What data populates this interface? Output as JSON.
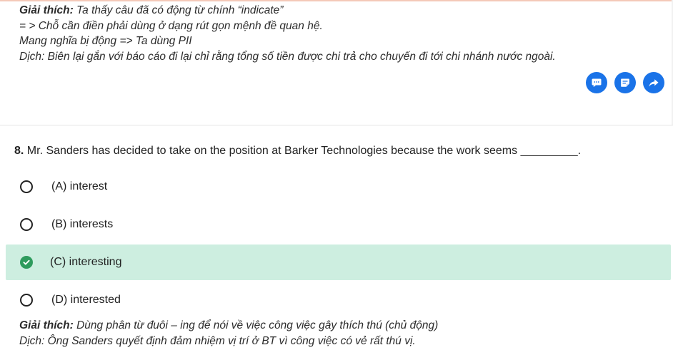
{
  "previous": {
    "explanation_label": "Giải thích:",
    "explanation_text": " Ta thấy câu đã có động từ chính “indicate”",
    "line2": "= > Chỗ cần điền phải dùng ở dạng rút gọn mệnh đề quan hệ.",
    "line3": "Mang nghĩa bị động => Ta dùng PII",
    "line4": "Dịch: Biên lại gắn với báo cáo đi lại chỉ rằng tổng số tiền được chi trả cho chuyến đi tới chi nhánh nước ngoài."
  },
  "actions": {
    "colors": {
      "button_bg": "#1a73e8"
    },
    "icons": [
      "comment-icon",
      "note-icon",
      "share-icon"
    ]
  },
  "question": {
    "number": "8.",
    "text": " Mr. Sanders has decided to take on the position at Barker Technologies because the work seems _________."
  },
  "options": [
    {
      "label": "(A) interest",
      "selected": false,
      "correct": false
    },
    {
      "label": "(B) interests",
      "selected": false,
      "correct": false
    },
    {
      "label": "(C) interesting",
      "selected": true,
      "correct": true
    },
    {
      "label": "(D) interested",
      "selected": false,
      "correct": false
    }
  ],
  "explanation": {
    "label": "Giải thích:",
    "text": " Dùng phân từ đuôi – ing để nói về việc công việc gây thích thú (chủ động)",
    "translation": "Dịch: Ông Sanders quyết định đảm nhiệm vị trí ở BT vì công việc có vẻ rất thú vị."
  },
  "colors": {
    "correct_bg": "#cdeee0",
    "check_green": "#2e9b5d"
  }
}
